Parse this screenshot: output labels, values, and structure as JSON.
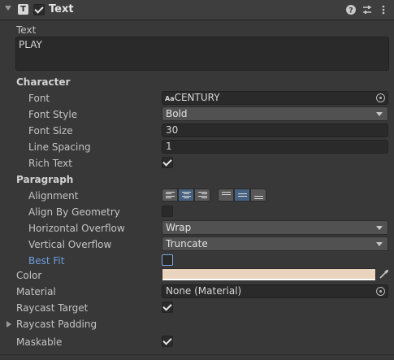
{
  "header": {
    "title": "Text",
    "component_icon_letter": "T",
    "enabled": true,
    "icons": [
      "help-icon",
      "presets-icon",
      "more-options-icon"
    ]
  },
  "text": {
    "label": "Text",
    "value": "PLAY"
  },
  "character": {
    "heading": "Character",
    "font": {
      "label": "Font",
      "icon_text": "Aa",
      "value": "CENTURY"
    },
    "font_style": {
      "label": "Font Style",
      "value": "Bold"
    },
    "font_size": {
      "label": "Font Size",
      "value": "30"
    },
    "line_spacing": {
      "label": "Line Spacing",
      "value": "1"
    },
    "rich_text": {
      "label": "Rich Text",
      "checked": true
    }
  },
  "paragraph": {
    "heading": "Paragraph",
    "alignment": {
      "label": "Alignment",
      "horizontal_selected": "center",
      "vertical_selected": "middle"
    },
    "align_by_geometry": {
      "label": "Align By Geometry",
      "checked": false
    },
    "horizontal_overflow": {
      "label": "Horizontal Overflow",
      "value": "Wrap"
    },
    "vertical_overflow": {
      "label": "Vertical Overflow",
      "value": "Truncate"
    },
    "best_fit": {
      "label": "Best Fit",
      "checked": false
    }
  },
  "color": {
    "label": "Color",
    "value": "#EBD4BD"
  },
  "material": {
    "label": "Material",
    "value": "None (Material)"
  },
  "raycast_target": {
    "label": "Raycast Target",
    "checked": true
  },
  "raycast_padding": {
    "label": "Raycast Padding",
    "expanded": false
  },
  "maskable": {
    "label": "Maskable",
    "checked": true
  },
  "colors": {
    "background": "#383838",
    "accent_label": "#6F9FE0",
    "selected_button": "#46607F"
  }
}
